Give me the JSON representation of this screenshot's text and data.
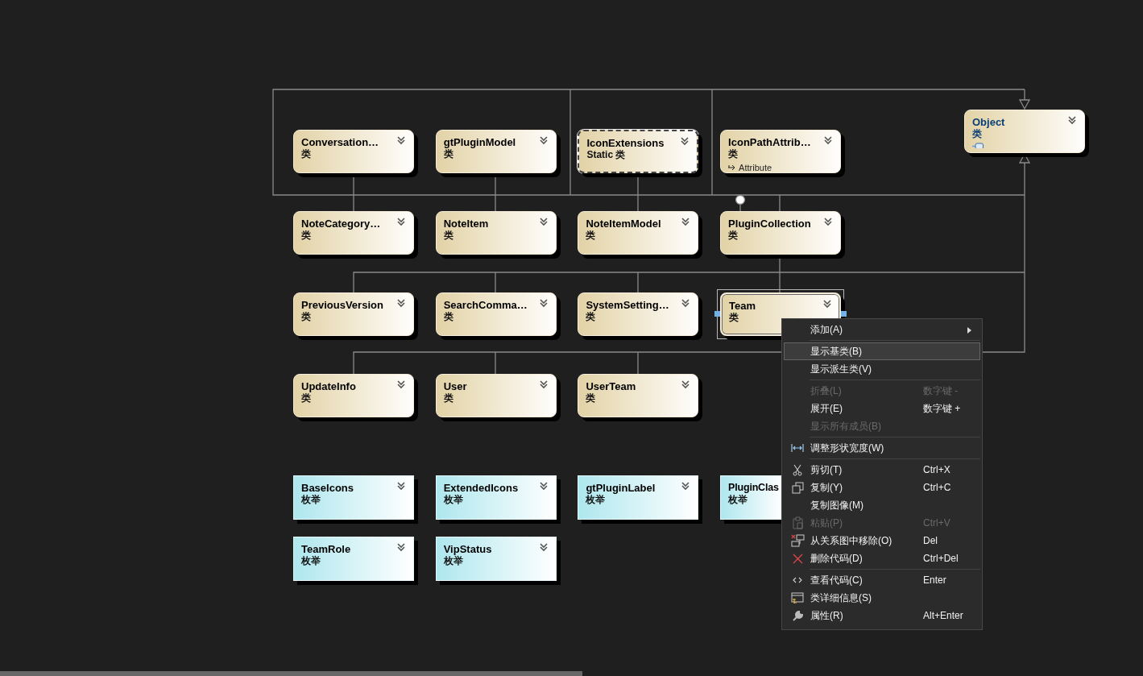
{
  "diagram": {
    "base_class": {
      "name": "Object",
      "subtitle": "类",
      "kind": "external",
      "selected": false
    },
    "class_rows": [
      [
        {
          "name": "Conversation…",
          "subtitle": "类",
          "kind": "class",
          "selected": false
        },
        {
          "name": "gtPluginModel",
          "subtitle": "类",
          "kind": "class",
          "selected": false
        },
        {
          "name": "IconExtensions",
          "subtitle": "Static 类",
          "kind": "static_class",
          "selected": false
        },
        {
          "name": "IconPathAttrib…",
          "subtitle": "类",
          "kind": "class",
          "base": "Attribute",
          "selected": false
        }
      ],
      [
        {
          "name": "NoteCategory…",
          "subtitle": "类",
          "kind": "class",
          "selected": false
        },
        {
          "name": "NoteItem",
          "subtitle": "类",
          "kind": "class",
          "selected": false
        },
        {
          "name": "NoteItemModel",
          "subtitle": "类",
          "kind": "class",
          "selected": false
        },
        {
          "name": "PluginCollection",
          "subtitle": "类",
          "kind": "class",
          "selected": false
        }
      ],
      [
        {
          "name": "PreviousVersion",
          "subtitle": "类",
          "kind": "class",
          "selected": false
        },
        {
          "name": "SearchComma…",
          "subtitle": "类",
          "kind": "class",
          "selected": false
        },
        {
          "name": "SystemSetting…",
          "subtitle": "类",
          "kind": "class",
          "selected": false
        },
        {
          "name": "Team",
          "subtitle": "类",
          "kind": "class",
          "selected": true
        }
      ],
      [
        {
          "name": "UpdateInfo",
          "subtitle": "类",
          "kind": "class",
          "selected": false
        },
        {
          "name": "User",
          "subtitle": "类",
          "kind": "class",
          "selected": false
        },
        {
          "name": "UserTeam",
          "subtitle": "类",
          "kind": "class",
          "selected": false
        }
      ]
    ],
    "enum_rows": [
      [
        {
          "name": "BaseIcons",
          "subtitle": "枚举",
          "kind": "enum",
          "selected": false,
          "clipped": false
        },
        {
          "name": "ExtendedIcons",
          "subtitle": "枚举",
          "kind": "enum",
          "selected": false,
          "clipped": false
        },
        {
          "name": "gtPluginLabel",
          "subtitle": "枚举",
          "kind": "enum",
          "selected": false,
          "clipped": false
        },
        {
          "name": "PluginClas",
          "subtitle": "枚举",
          "kind": "enum",
          "selected": false,
          "clipped": true
        }
      ],
      [
        {
          "name": "TeamRole",
          "subtitle": "枚举",
          "kind": "enum",
          "selected": false,
          "clipped": false
        },
        {
          "name": "VipStatus",
          "subtitle": "枚举",
          "kind": "enum",
          "selected": false,
          "clipped": false
        }
      ]
    ]
  },
  "context_menu": {
    "groups": [
      [
        {
          "label": "添加(A)",
          "kind": "plain",
          "submenu": true,
          "disabled": false,
          "selected": false
        }
      ],
      [
        {
          "label": "显示基类(B)",
          "kind": "plain",
          "submenu": false,
          "disabled": false,
          "selected": true
        },
        {
          "label": "显示派生类(V)",
          "kind": "plain",
          "submenu": false,
          "disabled": false,
          "selected": false
        }
      ],
      [
        {
          "label": "折叠(L)",
          "shortcut": "数字键 -",
          "kind": "plain",
          "submenu": false,
          "disabled": true,
          "selected": false
        },
        {
          "label": "展开(E)",
          "shortcut": "数字键 +",
          "kind": "plain",
          "submenu": false,
          "disabled": false,
          "selected": false
        },
        {
          "label": "显示所有成员(B)",
          "kind": "plain",
          "submenu": false,
          "disabled": true,
          "selected": false
        }
      ],
      [
        {
          "label": "调整形状宽度(W)",
          "kind": "resize",
          "submenu": false,
          "disabled": false,
          "selected": false
        }
      ],
      [
        {
          "label": "剪切(T)",
          "shortcut": "Ctrl+X",
          "kind": "cut",
          "submenu": false,
          "disabled": false,
          "selected": false
        },
        {
          "label": "复制(Y)",
          "shortcut": "Ctrl+C",
          "kind": "copy",
          "submenu": false,
          "disabled": false,
          "selected": false
        },
        {
          "label": "复制图像(M)",
          "kind": "plain",
          "submenu": false,
          "disabled": false,
          "selected": false
        },
        {
          "label": "粘贴(P)",
          "shortcut": "Ctrl+V",
          "kind": "paste",
          "submenu": false,
          "disabled": true,
          "selected": false
        },
        {
          "label": "从关系图中移除(O)",
          "shortcut": "Del",
          "kind": "remove",
          "submenu": false,
          "disabled": false,
          "selected": false
        },
        {
          "label": "删除代码(D)",
          "shortcut": "Ctrl+Del",
          "kind": "delete",
          "submenu": false,
          "disabled": false,
          "selected": false
        }
      ],
      [
        {
          "label": "查看代码(C)",
          "shortcut": "Enter",
          "kind": "code",
          "submenu": false,
          "disabled": false,
          "selected": false
        },
        {
          "label": "类详细信息(S)",
          "kind": "details",
          "submenu": false,
          "disabled": false,
          "selected": false
        },
        {
          "label": "属性(R)",
          "shortcut": "Alt+Enter",
          "kind": "properties",
          "submenu": false,
          "disabled": false,
          "selected": false
        }
      ]
    ]
  }
}
